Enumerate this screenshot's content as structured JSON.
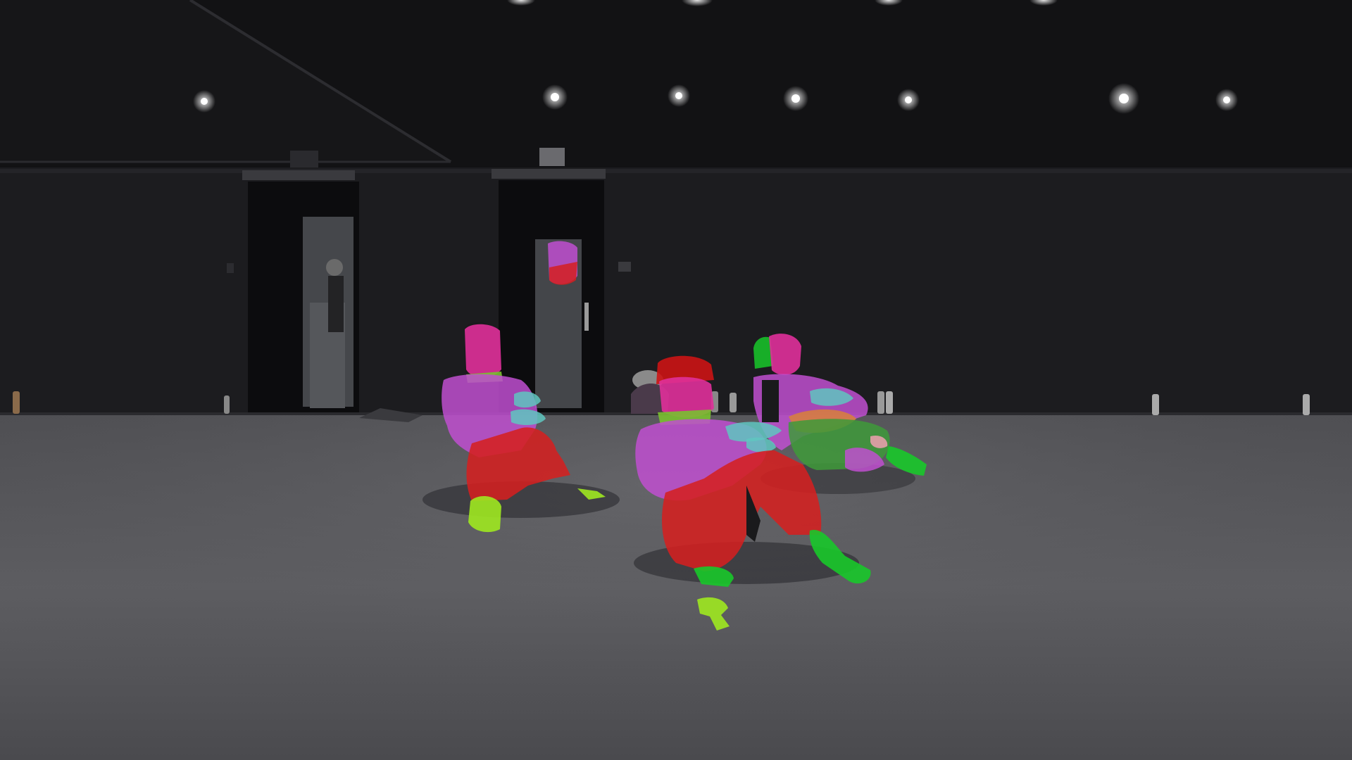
{
  "scene": {
    "description_type": "dance studio frame with human-parsing segmentation overlay",
    "palette": {
      "ceiling": "#141416",
      "wall": "#1d1d20",
      "floor": "#5a5a5e",
      "door_frame": "#0d0d0f",
      "door_glass": "#3a3c40",
      "light": "#ffffff"
    },
    "segmentation_classes": [
      {
        "name": "face",
        "color": "#e0309a"
      },
      {
        "name": "upper-clothes",
        "color": "#c04fd0"
      },
      {
        "name": "pants",
        "color": "#d42020"
      },
      {
        "name": "left-shoe",
        "color": "#9ee820"
      },
      {
        "name": "right-shoe",
        "color": "#18c82a"
      },
      {
        "name": "hand",
        "color": "#5fc6c0"
      },
      {
        "name": "hat",
        "color": "#cc1414"
      },
      {
        "name": "neck",
        "color": "#7ac030"
      },
      {
        "name": "skirt-or-coat",
        "color": "#3e9a3a"
      },
      {
        "name": "arm",
        "color": "#d8803a"
      }
    ]
  }
}
